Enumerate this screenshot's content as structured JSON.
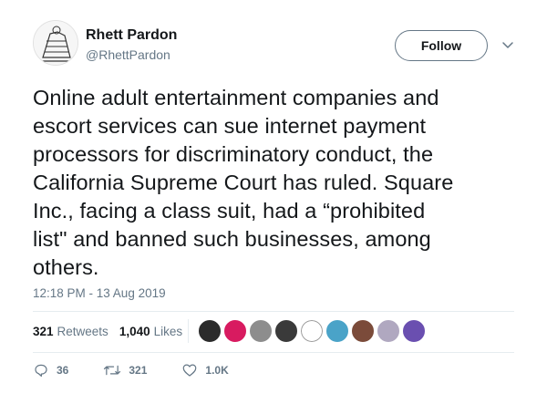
{
  "author": {
    "name": "Rhett Pardon",
    "handle": "@RhettPardon"
  },
  "follow_label": "Follow",
  "tweet": {
    "text": "Online adult entertainment companies and\nescort services can sue internet payment\nprocessors for discriminatory conduct, the\nCalifornia Supreme Court has ruled. Square\nInc., facing a class suit, had a “prohibited\nlist\" and banned such businesses, among\nothers.",
    "timestamp": "12:18 PM - 13 Aug 2019"
  },
  "stats": {
    "retweets_count": "321",
    "retweets_label": "Retweets",
    "likes_count": "1,040",
    "likes_label": "Likes"
  },
  "likers": [
    {
      "icon": "liker-avatar",
      "color": "#2b2b2b"
    },
    {
      "icon": "liker-avatar",
      "color": "#d81b60"
    },
    {
      "icon": "liker-avatar",
      "color": "#8d8d8d"
    },
    {
      "icon": "liker-avatar",
      "color": "#3a3a3a"
    },
    {
      "icon": "liker-avatar",
      "color": "#ffffff"
    },
    {
      "icon": "liker-avatar",
      "color": "#4aa3c8"
    },
    {
      "icon": "liker-avatar",
      "color": "#7b4b3a"
    },
    {
      "icon": "liker-avatar",
      "color": "#b0a8c0"
    },
    {
      "icon": "liker-avatar",
      "color": "#6a4fb0"
    }
  ],
  "actions": {
    "reply_count": "36",
    "retweet_count": "321",
    "like_count": "1.0K"
  },
  "colors": {
    "text": "#14171a",
    "secondary": "#657786",
    "divider": "#e6ecf0"
  }
}
